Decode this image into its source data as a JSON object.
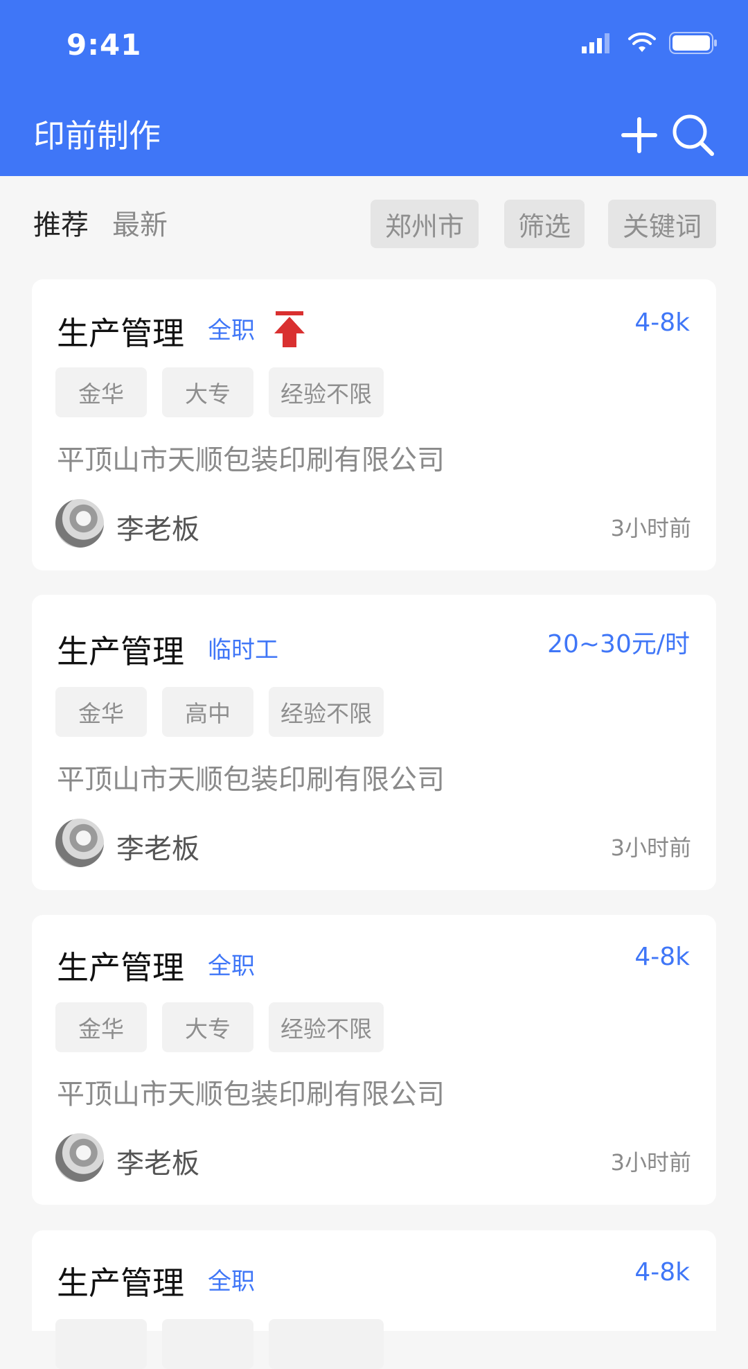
{
  "status_bar": {
    "time": "9:41"
  },
  "header": {
    "title": "印前制作"
  },
  "tabs": [
    "推荐",
    "最新"
  ],
  "filters": [
    "郑州市",
    "筛选",
    "关键词"
  ],
  "cards": [
    {
      "title": "生产管理",
      "type": "全职",
      "salary": "4-8k",
      "tags": [
        "金华",
        "大专",
        "经验不限"
      ],
      "company": "平顶山市天顺包装印刷有限公司",
      "boss": "李老板",
      "time": "3小时前"
    },
    {
      "title": "生产管理",
      "type": "临时工",
      "salary": "20~30元/时",
      "tags": [
        "金华",
        "高中",
        "经验不限"
      ],
      "company": "平顶山市天顺包装印刷有限公司",
      "boss": "李老板",
      "time": "3小时前"
    },
    {
      "title": "生产管理",
      "type": "全职",
      "salary": "4-8k",
      "tags": [
        "金华",
        "大专",
        "经验不限"
      ],
      "company": "平顶山市天顺包装印刷有限公司",
      "boss": "李老板",
      "time": "3小时前"
    },
    {
      "title": "生产管理",
      "type": "全职",
      "salary": "4-8k"
    }
  ],
  "colors": {
    "primary": "#3f76f7",
    "top_icon": "#d93030"
  },
  "icons": [
    "signal-icon",
    "wifi-icon",
    "battery-icon",
    "plus-icon",
    "search-icon",
    "pin-top-icon"
  ]
}
